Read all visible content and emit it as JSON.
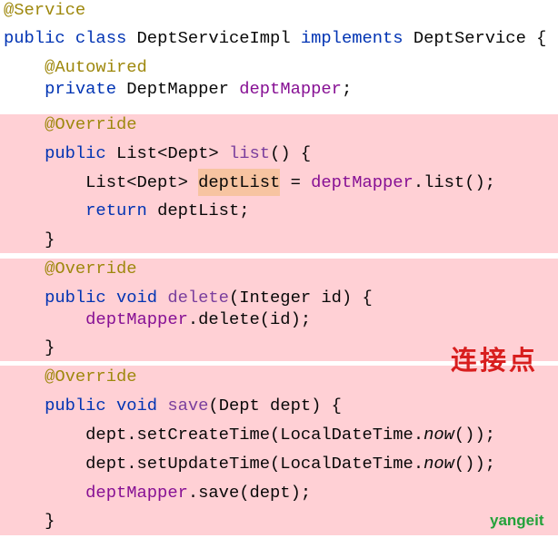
{
  "colors": {
    "annotation": "#9E880D",
    "keyword": "#0033B3",
    "field": "#871094",
    "method_declaration": "#7A3E9D",
    "plain": "#080808",
    "block_highlight": "#FFD0D5",
    "usage_highlight": "#F7C4A1",
    "label_text": "#D81E1E",
    "watermark": "#23A23A"
  },
  "code": {
    "lines": [
      {
        "tokens": [
          {
            "t": "@Service",
            "k": "annotation"
          }
        ]
      },
      {
        "tokens": [
          {
            "t": "public class ",
            "k": "keyword"
          },
          {
            "t": "DeptServiceImpl ",
            "k": "plain"
          },
          {
            "t": "implements ",
            "k": "keyword"
          },
          {
            "t": "DeptService {",
            "k": "plain"
          }
        ]
      },
      {
        "tokens": [
          {
            "t": "@Autowired",
            "k": "annotation"
          }
        ]
      },
      {
        "tokens": [
          {
            "t": "private ",
            "k": "keyword"
          },
          {
            "t": "DeptMapper ",
            "k": "plain"
          },
          {
            "t": "deptMapper",
            "k": "field"
          },
          {
            "t": ";",
            "k": "plain"
          }
        ]
      },
      {
        "tokens": [
          {
            "t": "@Override",
            "k": "annotation"
          }
        ]
      },
      {
        "tokens": [
          {
            "t": "public ",
            "k": "keyword"
          },
          {
            "t": "List<Dept> ",
            "k": "plain"
          },
          {
            "t": "list",
            "k": "method_declaration"
          },
          {
            "t": "() {",
            "k": "plain"
          }
        ]
      },
      {
        "tokens": [
          {
            "t": "List<Dept> ",
            "k": "plain"
          },
          {
            "t": "deptList",
            "k": "plain",
            "highlight": true
          },
          {
            "t": " = ",
            "k": "plain"
          },
          {
            "t": "deptMapper",
            "k": "field"
          },
          {
            "t": ".list();",
            "k": "plain"
          }
        ]
      },
      {
        "tokens": [
          {
            "t": "return ",
            "k": "keyword"
          },
          {
            "t": "deptList;",
            "k": "plain"
          }
        ]
      },
      {
        "tokens": [
          {
            "t": "}",
            "k": "plain"
          }
        ]
      },
      {
        "tokens": [
          {
            "t": "@Override",
            "k": "annotation"
          }
        ]
      },
      {
        "tokens": [
          {
            "t": "public void ",
            "k": "keyword"
          },
          {
            "t": "delete",
            "k": "method_declaration"
          },
          {
            "t": "(Integer id) {",
            "k": "plain"
          }
        ]
      },
      {
        "tokens": [
          {
            "t": "deptMapper",
            "k": "field"
          },
          {
            "t": ".delete(id);",
            "k": "plain"
          }
        ]
      },
      {
        "tokens": [
          {
            "t": "}",
            "k": "plain"
          }
        ]
      },
      {
        "tokens": [
          {
            "t": "@Override",
            "k": "annotation"
          }
        ]
      },
      {
        "tokens": [
          {
            "t": "public void ",
            "k": "keyword"
          },
          {
            "t": "save",
            "k": "method_declaration"
          },
          {
            "t": "(Dept dept) {",
            "k": "plain"
          }
        ]
      },
      {
        "tokens": [
          {
            "t": "dept.setCreateTime(LocalDateTime.",
            "k": "plain"
          },
          {
            "t": "now",
            "k": "static_call"
          },
          {
            "t": "());",
            "k": "plain"
          }
        ]
      },
      {
        "tokens": [
          {
            "t": "dept.setUpdateTime(LocalDateTime.",
            "k": "plain"
          },
          {
            "t": "now",
            "k": "static_call"
          },
          {
            "t": "());",
            "k": "plain"
          }
        ]
      },
      {
        "tokens": [
          {
            "t": "deptMapper",
            "k": "field"
          },
          {
            "t": ".save(dept);",
            "k": "plain"
          }
        ]
      },
      {
        "tokens": [
          {
            "t": "}",
            "k": "plain"
          }
        ]
      }
    ]
  },
  "overlay": {
    "label": "连接点",
    "watermark": "yangeit"
  }
}
